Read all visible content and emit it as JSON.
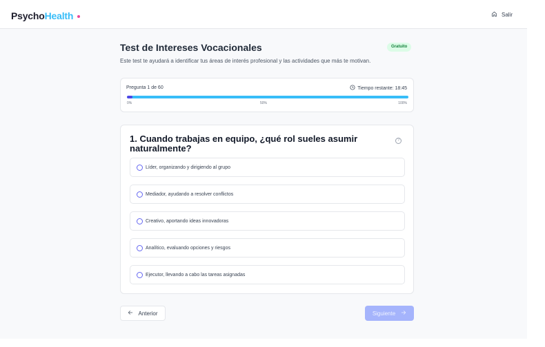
{
  "header": {
    "logo_part1": "Psycho",
    "logo_part2": "Health",
    "exit_label": "Salir",
    "exit_icon": "home-icon"
  },
  "test": {
    "title": "Test de Intereses Vocacionales",
    "badge": "Gratuito",
    "description": "Este test te ayudará a identificar tus áreas de interés profesional y las actividades que más te motivan."
  },
  "progress": {
    "question_label": "Pregunta 1 de 60",
    "timer_label": "Tiempo restante: 18:45",
    "fraction": 0.02,
    "tick_start": "0%",
    "tick_mid": "50%",
    "tick_end": "100%"
  },
  "question": {
    "text": "1. Cuando trabajas en equipo, ¿qué rol sueles asumir naturalmente?",
    "help_icon": "?",
    "options": [
      {
        "label": "Líder, organizando y dirigiendo al grupo"
      },
      {
        "label": "Mediador, ayudando a resolver conflictos"
      },
      {
        "label": "Creativo, aportando ideas innovadoras"
      },
      {
        "label": "Analítico, evaluando opciones y riesgos"
      },
      {
        "label": "Ejecutor, llevando a cabo las tareas asignadas"
      }
    ]
  },
  "navigation": {
    "prev_label": "Anterior",
    "next_label": "Siguiente"
  },
  "colors": {
    "brand_dark": "#1f1f2e",
    "brand_accent": "#38bdf8",
    "brand_dot": "#ec4899",
    "primary": "#6366f1",
    "badge_bg": "#dcfce7",
    "badge_text": "#15803d"
  }
}
